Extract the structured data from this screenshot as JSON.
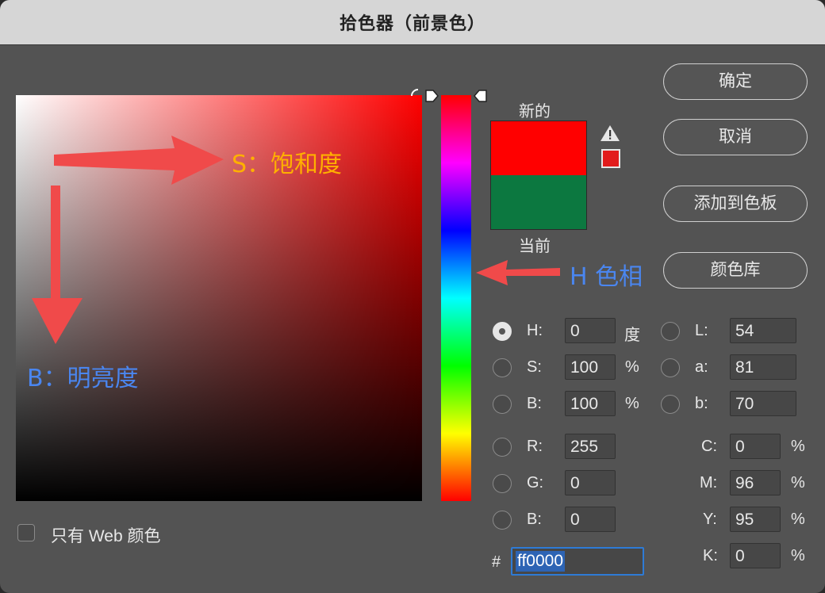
{
  "window": {
    "title": "拾色器（前景色）"
  },
  "annotations": {
    "saturation": "S：饱和度",
    "brightness": "B：明亮度",
    "hue": "H 色相"
  },
  "preview": {
    "new_label": "新的",
    "current_label": "当前",
    "new_color": "#ff0000",
    "current_color": "#0c7840"
  },
  "buttons": {
    "ok": "确定",
    "cancel": "取消",
    "add_to_swatches": "添加到色板",
    "color_libraries": "颜色库"
  },
  "hsb": {
    "h": {
      "label": "H:",
      "value": "0",
      "unit": "度"
    },
    "s": {
      "label": "S:",
      "value": "100",
      "unit": "%"
    },
    "b": {
      "label": "B:",
      "value": "100",
      "unit": "%"
    }
  },
  "lab": {
    "l": {
      "label": "L:",
      "value": "54"
    },
    "a": {
      "label": "a:",
      "value": "81"
    },
    "b": {
      "label": "b:",
      "value": "70"
    }
  },
  "rgb": {
    "r": {
      "label": "R:",
      "value": "255"
    },
    "g": {
      "label": "G:",
      "value": "0"
    },
    "b": {
      "label": "B:",
      "value": "0"
    }
  },
  "cmyk": {
    "c": {
      "label": "C:",
      "value": "0",
      "unit": "%"
    },
    "m": {
      "label": "M:",
      "value": "96",
      "unit": "%"
    },
    "y": {
      "label": "Y:",
      "value": "95",
      "unit": "%"
    },
    "k": {
      "label": "K:",
      "value": "0",
      "unit": "%"
    }
  },
  "hex": {
    "label": "#",
    "value": "ff0000"
  },
  "web_only": {
    "label": "只有 Web 颜色",
    "checked": false
  },
  "hue_base_color": "#ff0000",
  "selected_mode": "H"
}
